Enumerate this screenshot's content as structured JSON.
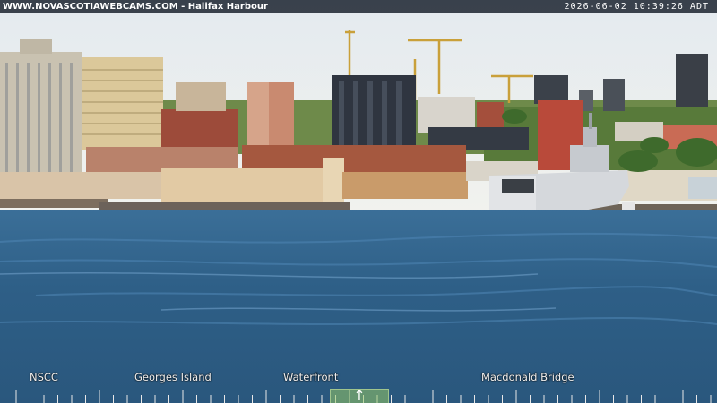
{
  "overlay": {
    "site_caption": "WWW.NOVASCOTIAWEBCAMS.COM - Halifax Harbour",
    "timestamp": "2026-06-02  10:39:26 ADT"
  },
  "view_labels": [
    {
      "text": "NSCC"
    },
    {
      "text": "Georges Island"
    },
    {
      "text": "Waterfront"
    },
    {
      "text": "Macdonald Bridge"
    }
  ],
  "center_control": {
    "glyph": "↑",
    "icon": "up-arrow-icon"
  },
  "colors": {
    "sky": "#e9edf0",
    "water": "#2f5f86",
    "overlay_bar": "#141c28",
    "control_green": "#96c864"
  }
}
